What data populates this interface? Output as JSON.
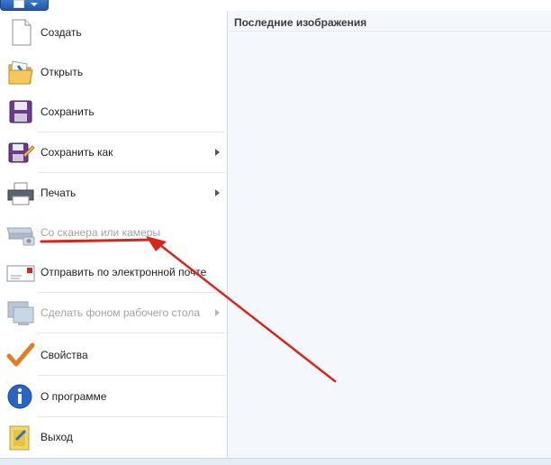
{
  "panel": {
    "title": "Последние изображения"
  },
  "menu": {
    "items": [
      {
        "label": "Создать",
        "icon": "new-document-icon",
        "submenu": false,
        "disabled": false
      },
      {
        "label": "Открыть",
        "icon": "open-folder-icon",
        "submenu": false,
        "disabled": false
      },
      {
        "label": "Сохранить",
        "icon": "save-disk-icon",
        "submenu": false,
        "disabled": false
      },
      {
        "label": "Сохранить как",
        "icon": "save-as-icon",
        "submenu": true,
        "disabled": false
      },
      {
        "label": "Печать",
        "icon": "printer-icon",
        "submenu": true,
        "disabled": false
      },
      {
        "label": "Со сканера или камеры",
        "icon": "scanner-camera-icon",
        "submenu": false,
        "disabled": true
      },
      {
        "label": "Отправить по электронной почте",
        "icon": "email-icon",
        "submenu": false,
        "disabled": false
      },
      {
        "label": "Сделать фоном рабочего стола",
        "icon": "desktop-background-icon",
        "submenu": true,
        "disabled": true
      },
      {
        "label": "Свойства",
        "icon": "checkmark-icon",
        "submenu": false,
        "disabled": false
      },
      {
        "label": "О программе",
        "icon": "info-icon",
        "submenu": false,
        "disabled": false
      },
      {
        "label": "Выход",
        "icon": "exit-icon",
        "submenu": false,
        "disabled": false
      }
    ]
  },
  "annotation": {
    "color": "#d9261c",
    "highlighted_item": "Со сканера или камеры"
  }
}
